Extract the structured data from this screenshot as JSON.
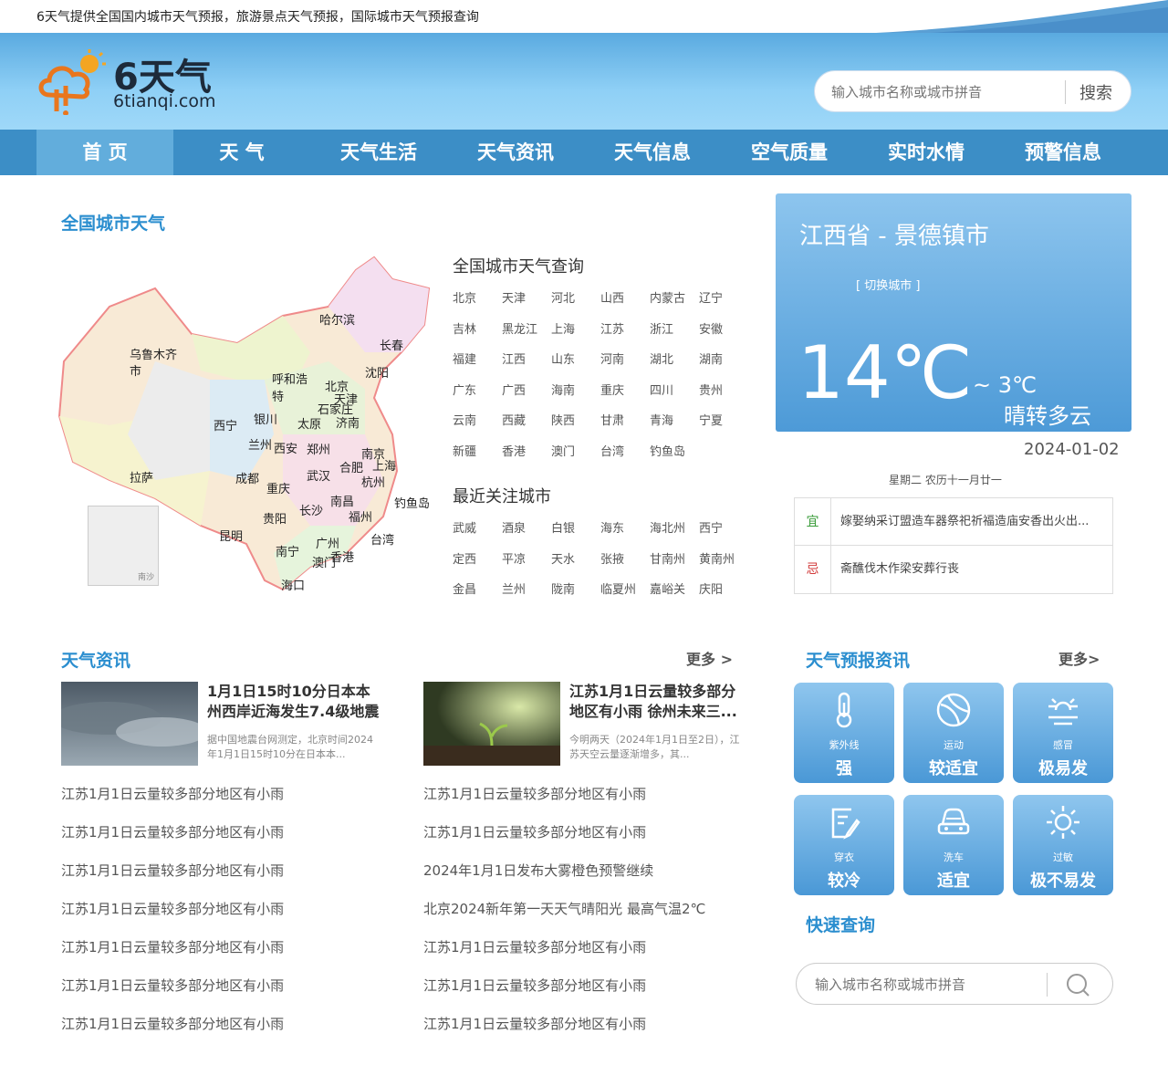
{
  "topbar": {
    "text": "6天气提供全国国内城市天气预报，旅游景点天气预报，国际城市天气预报查询"
  },
  "logo": {
    "cn": "6天气",
    "en": "6tianqi.com"
  },
  "search_top": {
    "placeholder": "输入城市名称或城市拼音",
    "button": "搜索"
  },
  "nav": [
    "首 页",
    "天 气",
    "天气生活",
    "天气资讯",
    "天气信息",
    "空气质量",
    "实时水情",
    "预警信息"
  ],
  "map_section": {
    "title": "全国城市天气",
    "map_labels": [
      "哈尔滨",
      "长春",
      "乌鲁木齐",
      "市",
      "呼和浩",
      "特",
      "北京",
      "沈阳",
      "天津",
      "石家庄",
      "西宁",
      "银川",
      "太原",
      "济南",
      "兰州",
      "西安",
      "郑州",
      "南京",
      "上海",
      "合肥",
      "拉萨",
      "成都",
      "重庆",
      "武汉",
      "杭州",
      "钓鱼岛",
      "南昌",
      "长沙",
      "福州",
      "贵阳",
      "昆明",
      "台湾",
      "南宁",
      "广州",
      "澳门",
      "香港",
      "海口",
      "南沙"
    ]
  },
  "city_query": {
    "title": "全国城市天气查询",
    "cities": [
      "北京",
      "天津",
      "河北",
      "山西",
      "内蒙古",
      "辽宁",
      "吉林",
      "黑龙江",
      "上海",
      "江苏",
      "浙江",
      "安徽",
      "福建",
      "江西",
      "山东",
      "河南",
      "湖北",
      "湖南",
      "广东",
      "广西",
      "海南",
      "重庆",
      "四川",
      "贵州",
      "云南",
      "西藏",
      "陕西",
      "甘肃",
      "青海",
      "宁夏",
      "新疆",
      "香港",
      "澳门",
      "台湾",
      "钓鱼岛"
    ]
  },
  "recent": {
    "title": "最近关注城市",
    "cities": [
      "武威",
      "酒泉",
      "白银",
      "海东",
      "海北州",
      "西宁",
      "定西",
      "平凉",
      "天水",
      "张掖",
      "甘南州",
      "黄南州",
      "金昌",
      "兰州",
      "陇南",
      "临夏州",
      "嘉峪关",
      "庆阳"
    ]
  },
  "weather": {
    "location": "江西省 - 景德镇市",
    "switch": "[ 切换城市 ]",
    "temp": "14℃",
    "low": "~ 3℃",
    "desc": "晴转多云",
    "date": "2024-01-02",
    "lunar": "星期二  农历十一月廿一"
  },
  "almanac": {
    "yi_label": "宜",
    "yi_text": "嫁娶纳采订盟造车器祭祀祈福造庙安香出火出...",
    "ji_label": "忌",
    "ji_text": "斋醮伐木作梁安葬行丧"
  },
  "news": {
    "title": "天气资讯",
    "more": "更多 >",
    "featured": [
      {
        "title": "1月1日15时10分日本本州西岸近海发生7.4级地震",
        "summary": "据中国地震台网测定，北京时间2024年1月1日15时10分在日本本..."
      },
      {
        "title": "江苏1月1日云量较多部分地区有小雨 徐州未来三...",
        "summary": "今明两天（2024年1月1日至2日），江苏天空云量逐渐增多，其..."
      }
    ],
    "left": [
      "江苏1月1日云量较多部分地区有小雨",
      "江苏1月1日云量较多部分地区有小雨",
      "江苏1月1日云量较多部分地区有小雨",
      "江苏1月1日云量较多部分地区有小雨",
      "江苏1月1日云量较多部分地区有小雨",
      "江苏1月1日云量较多部分地区有小雨",
      "江苏1月1日云量较多部分地区有小雨"
    ],
    "right": [
      "江苏1月1日云量较多部分地区有小雨",
      "江苏1月1日云量较多部分地区有小雨",
      "2024年1月1日发布大雾橙色预警继续",
      "北京2024新年第一天天气晴阳光 最高气温2℃",
      "江苏1月1日云量较多部分地区有小雨",
      "江苏1月1日云量较多部分地区有小雨",
      "江苏1月1日云量较多部分地区有小雨"
    ]
  },
  "forecast": {
    "title": "天气预报资讯",
    "more": "更多>",
    "tiles": [
      {
        "name": "紫外线",
        "value": "强",
        "icon": "thermometer-icon"
      },
      {
        "name": "运动",
        "value": "较适宜",
        "icon": "ball-icon"
      },
      {
        "name": "感冒",
        "value": "极易发",
        "icon": "sun-low-icon"
      },
      {
        "name": "穿衣",
        "value": "较冷",
        "icon": "clipboard-pen-icon"
      },
      {
        "name": "洗车",
        "value": "适宜",
        "icon": "car-icon"
      },
      {
        "name": "过敏",
        "value": "极不易发",
        "icon": "sun-icon"
      }
    ]
  },
  "quick": {
    "title": "快速查询",
    "placeholder": "输入城市名称或城市拼音"
  },
  "colors": {
    "accent": "#2b8ecf",
    "nav": "#3c8ec6",
    "nav_active": "#62addc",
    "yi": "#3a9c3a",
    "ji": "#d23a3a"
  }
}
